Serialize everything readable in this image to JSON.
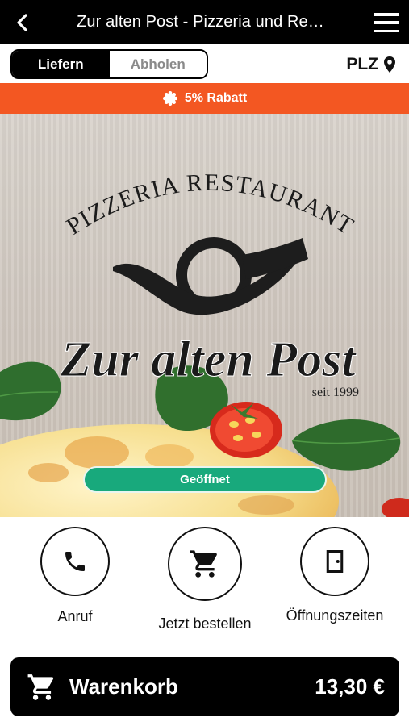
{
  "header": {
    "title": "Zur alten Post - Pizzeria und Re…",
    "back_icon": "chevron-left-icon",
    "menu_icon": "hamburger-menu-icon"
  },
  "mode": {
    "options": [
      "Liefern",
      "Abholen"
    ],
    "selected": "Liefern",
    "plz_label": "PLZ",
    "plz_icon": "map-pin-icon"
  },
  "discount": {
    "label": "5% Rabatt",
    "icon": "badge-icon",
    "color": "#f35722"
  },
  "hero": {
    "logo_arc_text": "PIZZERIA RESTAURANT",
    "logo_name": "Zur alten Post",
    "logo_since": "seit 1999",
    "status": "Geöffnet",
    "status_color": "#18a97c"
  },
  "actions": [
    {
      "label": "Anruf",
      "icon": "phone-icon"
    },
    {
      "label": "Jetzt bestellen",
      "icon": "cart-icon"
    },
    {
      "label": "Öffnungszeiten",
      "icon": "door-icon"
    }
  ],
  "cart": {
    "label": "Warenkorb",
    "total": "13,30 €",
    "icon": "cart-icon"
  }
}
